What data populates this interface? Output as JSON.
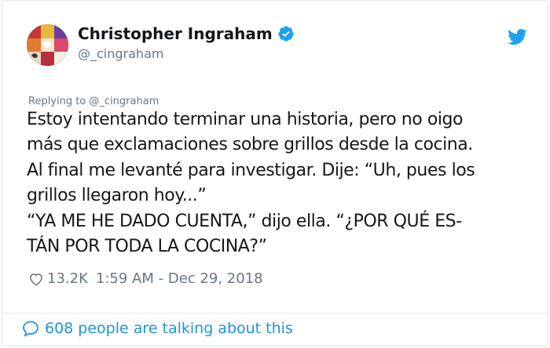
{
  "author": {
    "name": "Christopher Ingraham",
    "handle": "@_cingraham",
    "verified": true
  },
  "icons": {
    "avatar": "avatar-image",
    "verified": "verified-badge-icon",
    "logo": "twitter-bird-icon",
    "like": "heart-icon",
    "talk": "speech-bubble-icon"
  },
  "colors": {
    "brand_blue": "#1da1f2",
    "link_blue": "#1b95e0",
    "muted_gray": "#657786",
    "text_dark": "#14171a"
  },
  "tweet": {
    "reply_to": "Replying to @_cingraham",
    "lines": [
      "Estoy intentando terminar una historia, pero no oigo",
      "más que exclamaciones sobre grillos desde la cocina.",
      "Al final me levanté para investigar. Dije: “Uh, pues los",
      "grillos llegaron hoy...”",
      "“YA ME HE DADO CUENTA,” dijo ella. “¿POR QUÉ ES-",
      "TÁN POR TODA LA COCINA?”"
    ],
    "likes": "13.2K",
    "time": "1:59 AM",
    "separator": "-",
    "date": "Dec 29, 2018"
  },
  "footer": {
    "talking": "608 people are talking about this"
  }
}
